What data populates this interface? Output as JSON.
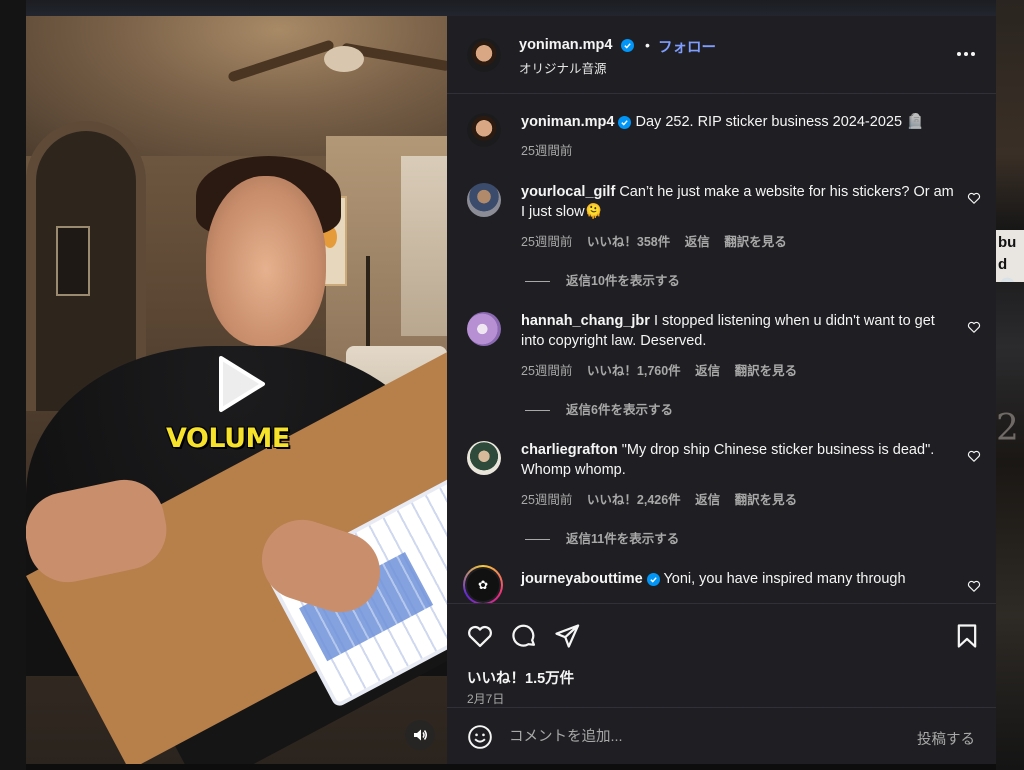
{
  "post": {
    "username": "yoniman.mp4",
    "follow_label": "フォロー",
    "dot": "•",
    "audio": "オリジナル音源",
    "video_caption": "VOLUME"
  },
  "caption": {
    "username": "yoniman.mp4",
    "text": "Day 252. RIP sticker business 2024-2025 🪦",
    "time": "25週間前"
  },
  "comments": [
    {
      "username": "yourlocal_gilf",
      "text": "Can’t he just make a website for his stickers? Or am I just slow🫠",
      "time": "25週間前",
      "likes": "いいね！358件",
      "reply": "返信",
      "translate": "翻訳を見る",
      "view_replies": "返信10件を表示する"
    },
    {
      "username": "hannah_chang_jbr",
      "text": "I stopped listening when u didn't want to get into copyright law. Deserved.",
      "time": "25週間前",
      "likes": "いいね！1,760件",
      "reply": "返信",
      "translate": "翻訳を見る",
      "view_replies": "返信6件を表示する"
    },
    {
      "username": "charliegrafton",
      "text": "\"My drop ship Chinese sticker business is dead\". Whomp whomp.",
      "time": "25週間前",
      "likes": "いいね！2,426件",
      "reply": "返信",
      "translate": "翻訳を見る",
      "view_replies": "返信11件を表示する"
    },
    {
      "username": "journeyabouttime",
      "text": "Yoni, you have inspired many through"
    }
  ],
  "stats": {
    "likes": "いいね！1.5万件",
    "date": "2月7日"
  },
  "composer": {
    "placeholder": "コメントを追加...",
    "post_label": "投稿する"
  },
  "background": {
    "side_text": "bu d 💀",
    "side_number": "2"
  },
  "colors": {
    "panel_bg": "#1f1f23",
    "link_blue": "#7f9dff",
    "verified_blue": "#0095f6",
    "caption_yellow": "#f7e22b"
  },
  "icons": [
    "play-icon",
    "volume-icon",
    "verified-icon",
    "more-icon",
    "heart-icon",
    "comment-icon",
    "share-icon",
    "bookmark-icon",
    "emoji-icon"
  ]
}
